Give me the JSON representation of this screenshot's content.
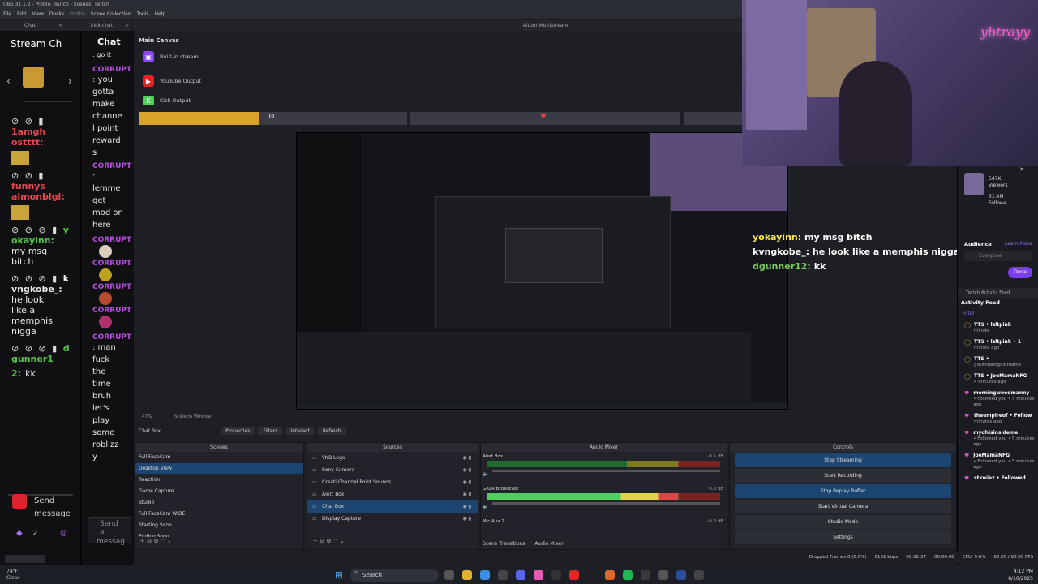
{
  "window": {
    "title": "OBS 31.1.2 - Profile: Twitch - Scenes: Twitch"
  },
  "menu": [
    "File",
    "Edit",
    "View",
    "Docks",
    "Profile",
    "Scene Collection",
    "Tools",
    "Help"
  ],
  "dock_tabs": [
    {
      "label": "Chat"
    },
    {
      "label": "kick chat"
    }
  ],
  "left_chat": {
    "title": "Stream Ch",
    "messages": [
      {
        "name": "1amgh",
        "name2": "ostttt:",
        "color": "#e8464e"
      },
      {
        "name": "funnys",
        "name2": "almonblgl:",
        "color": "#e8464e"
      },
      {
        "name": "y",
        "name2": "okayinn:",
        "text": [
          "my msg",
          "bitch"
        ],
        "color": "#55c247"
      },
      {
        "name": "k",
        "name2": "vngkobe_:",
        "text": [
          "he look",
          "like a",
          "memphis",
          "nigga"
        ],
        "color": "#e8e8e8"
      },
      {
        "name": "d",
        "name2": "gunner1",
        "name3": "2:",
        "text": [
          "kk"
        ],
        "color": "#55c247"
      }
    ],
    "send_label": "Send",
    "send_sub": "message",
    "bottom_count": "2"
  },
  "kick_chat": {
    "title": "Chat",
    "lines": [
      ": go it"
    ],
    "messages": [
      {
        "name": "CORRUPT",
        "text": [
          ": you",
          "gotta",
          "make",
          "channe",
          "l point",
          "reward",
          "s"
        ]
      },
      {
        "name": "CORRUPT",
        "text": [
          ":",
          "lemme",
          "get",
          "mod on",
          "here"
        ]
      },
      {
        "name": "CORRUPT",
        "text": []
      },
      {
        "name": "CORRUPT",
        "text": []
      },
      {
        "name": "CORRUPT",
        "text": []
      },
      {
        "name": "CORRUPT",
        "text": []
      },
      {
        "name": "CORRUPT",
        "text": [
          ": man",
          "fuck",
          "the",
          "time",
          "bruh",
          "let's",
          "play",
          "some",
          "roblizz",
          "y"
        ]
      }
    ],
    "send_label": "Send a",
    "send_sub": "messag"
  },
  "multistream": {
    "title": "Aitum Multistream"
  },
  "main_canvas": {
    "title": "Main Canvas",
    "outputs": [
      {
        "label": "Built-in stream",
        "color": "#8c45f7",
        "glyph": "▣"
      },
      {
        "label": "YouTube Output",
        "color": "#e32424",
        "glyph": "▶"
      },
      {
        "label": "Kick Output",
        "color": "#4fd15c",
        "glyph": "K"
      }
    ]
  },
  "progress": {
    "main": 0.45
  },
  "overlay_chat": [
    {
      "user": "yokayinn:",
      "text": "my msg bitch",
      "ucolor": "#ffe94a"
    },
    {
      "user": "kvngkobe_:",
      "text": "he look like a memphis nigga",
      "ucolor": "#ffffff"
    },
    {
      "user": "dgunner12:",
      "text": "kk",
      "ucolor": "#79d05a"
    }
  ],
  "webcam": {
    "neon_text": "ybtrayy"
  },
  "right_dock": {
    "stats": [
      "547K",
      "Viewers",
      "31.4M",
      "Followe"
    ],
    "audience_label": "Audience",
    "learn_more": "Learn More",
    "audience_value": "Everyone",
    "done_label": "Done",
    "activity_header": "Twitch Activity Feed",
    "activity_title": "Activity Feed",
    "filter_label": "Filter",
    "items": [
      {
        "icon": "tts",
        "name": "TTS • lsltpink",
        "sub": "minute"
      },
      {
        "icon": "tts",
        "name": "TTS • lsltpink • 1",
        "sub": "minute ago"
      },
      {
        "icon": "tts",
        "name": "TTS •",
        "sub": "glwithbeingastreame"
      },
      {
        "icon": "tts",
        "name": "TTS • JoeMamaNFG",
        "sub": "4 minutes ago"
      },
      {
        "icon": "heart",
        "name": "morningwoodmanny",
        "sub": "• Followed you • 5 minutes ago"
      },
      {
        "icon": "heart",
        "name": "theempireof • Follow",
        "sub": "minutes ago"
      },
      {
        "icon": "heart",
        "name": "mydhisinsideme",
        "sub": "• Followed you • 5 minutes ago"
      },
      {
        "icon": "heart",
        "name": "JoeMamaNFG",
        "sub": "• Followed you • 5 minutes ago"
      },
      {
        "icon": "heart",
        "name": "stkwiez • Followed",
        "sub": ""
      }
    ]
  },
  "toolbar": {
    "scene_label": "Chat Box",
    "buttons": [
      "Properties",
      "Filters",
      "Interact",
      "Refresh"
    ],
    "zoom": "47%",
    "scale_label": "Scale to Window"
  },
  "scenes": {
    "header": "Scenes",
    "items": [
      "Full FaceCam",
      "Desktop View",
      "Reaction",
      "Game Capture",
      "Studio",
      "Full FaceCam WIDE",
      "Starting Soon",
      "Ending Soon"
    ],
    "selected": 1
  },
  "sources": {
    "header": "Sources",
    "items": [
      "YNB Logo",
      "Sony Camera",
      "Creati Channel Point Sounds",
      "Alert Box",
      "Chat Box",
      "Display Capture"
    ],
    "selected": 4
  },
  "mixer": {
    "header": "Audio Mixer",
    "channels": [
      {
        "label": "Alert Box",
        "db": "-9.5 dB",
        "level": 0.0
      },
      {
        "label": "GXLR Broadcast",
        "db": "0.0 dB",
        "level": 0.82
      },
      {
        "label": "Mic/Aux 2",
        "db": "-0.0 dB",
        "level": 0.0
      }
    ],
    "tabs": [
      "Scene Transitions",
      "Audio Mixer"
    ]
  },
  "controls": {
    "header": "Controls",
    "buttons": [
      "Stop Streaming",
      "Start Recording",
      "Stop Replay Buffer",
      "Start Virtual Camera",
      "Studio Mode",
      "Settings"
    ]
  },
  "status": {
    "dropped": "Dropped Frames 0 (0.0%)",
    "kbps": "6181 kbps",
    "live_time": "00:52:37",
    "rec_time": "00:00:00",
    "cpu": "CPU: 9.6%",
    "fps": "60.00 / 60.00 FPS"
  },
  "taskbar": {
    "search": "Search",
    "weather_temp": "74°F",
    "weather_desc": "Clear",
    "time": "4:12 PM",
    "date": "8/10/2025"
  },
  "colors": {
    "accent": "#1c4571",
    "twitch": "#8c45f7",
    "youtube": "#e32424",
    "progress": "#d9a32a"
  }
}
